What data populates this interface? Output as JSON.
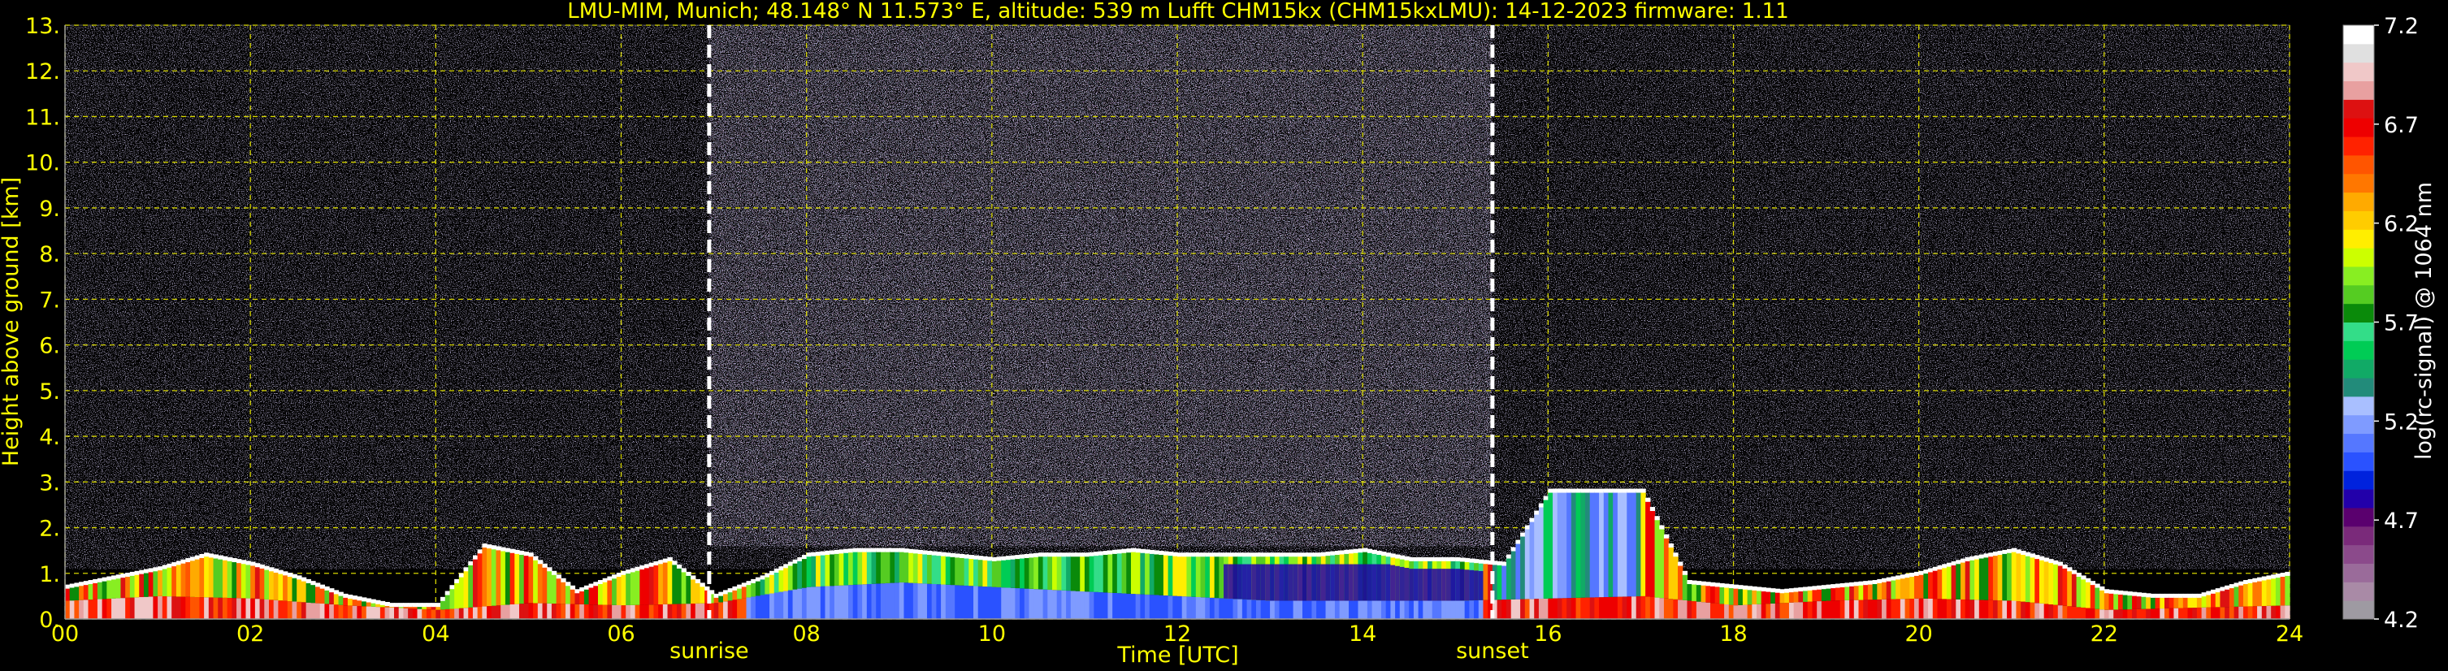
{
  "chart_data": {
    "type": "heatmap",
    "title": "LMU-MIM, Munich; 48.148° N 11.573° E, altitude: 539 m    Lufft CHM15kx (CHM15kxLMU): 14-12-2023    firmware: 1.11",
    "xlabel": "Time [UTC]",
    "ylabel": "Height above ground [km]",
    "xlim": [
      0,
      24
    ],
    "ylim": [
      0,
      13
    ],
    "x_ticks": [
      "00",
      "02",
      "04",
      "06",
      "08",
      "10",
      "12",
      "14",
      "16",
      "18",
      "20",
      "22",
      "24"
    ],
    "y_ticks": [
      "0.",
      "1.",
      "2.",
      "3.",
      "4.",
      "5.",
      "6.",
      "7.",
      "8.",
      "9.",
      "10.",
      "11.",
      "12.",
      "13."
    ],
    "grid": true,
    "markers": [
      {
        "label": "sunrise",
        "time": 6.95
      },
      {
        "label": "sunset",
        "time": 15.4
      }
    ],
    "colorbar": {
      "label": "log(rc-signal) @ 1064 nm",
      "range": [
        4.2,
        7.2
      ],
      "ticks": [
        "4.2",
        "4.7",
        "5.2",
        "5.7",
        "6.2",
        "6.7",
        "7.2"
      ],
      "colors": [
        "#9e9aa2",
        "#a98aa6",
        "#9a6b9a",
        "#8b4a8b",
        "#7a2a7a",
        "#5a006e",
        "#2200aa",
        "#0022dd",
        "#2a52ff",
        "#5577ff",
        "#7f9bff",
        "#a9bfff",
        "#228b7a",
        "#11aa66",
        "#00cc55",
        "#33dd88",
        "#0a8a0a",
        "#55cc22",
        "#88ee22",
        "#ccff00",
        "#ffee00",
        "#ffcc00",
        "#ffaa00",
        "#ff7700",
        "#ff5500",
        "#ff2200",
        "#ee0000",
        "#dd1111",
        "#e8a0a0",
        "#f0c8c8",
        "#e0e0e0",
        "#ffffff"
      ]
    },
    "series": [
      {
        "layer": "boundary_layer_top",
        "x": [
          0,
          0.5,
          1,
          1.5,
          2,
          2.5,
          3,
          3.5,
          4,
          4.5,
          5,
          5.5,
          6,
          6.5,
          7,
          7.5,
          8,
          8.5,
          9,
          9.5,
          10,
          10.5,
          11,
          11.5,
          12,
          12.5,
          13,
          13.5,
          14,
          14.5,
          15,
          15.5,
          16,
          16.5,
          17,
          17.5,
          18,
          18.5,
          19,
          19.5,
          20,
          20.5,
          21,
          21.5,
          22,
          22.5,
          23,
          23.5,
          24
        ],
        "y": [
          0.7,
          0.9,
          1.1,
          1.4,
          1.2,
          0.9,
          0.5,
          0.3,
          0.3,
          1.6,
          1.4,
          0.6,
          1.0,
          1.3,
          0.5,
          0.9,
          1.4,
          1.5,
          1.5,
          1.4,
          1.3,
          1.4,
          1.4,
          1.5,
          1.4,
          1.4,
          1.4,
          1.4,
          1.5,
          1.3,
          1.3,
          1.2,
          2.8,
          2.8,
          2.8,
          0.8,
          0.7,
          0.6,
          0.7,
          0.8,
          1.0,
          1.3,
          1.5,
          1.2,
          0.6,
          0.5,
          0.5,
          0.8,
          1.0
        ]
      },
      {
        "layer": "surface_layer_top",
        "x": [
          0,
          1,
          2,
          3,
          4,
          5,
          6,
          7,
          8,
          9,
          10,
          11,
          12,
          13,
          14,
          15,
          16,
          17,
          18,
          19,
          20,
          21,
          22,
          23,
          24
        ],
        "y": [
          0.4,
          0.5,
          0.45,
          0.3,
          0.2,
          0.35,
          0.3,
          0.35,
          0.7,
          0.8,
          0.7,
          0.6,
          0.5,
          0.4,
          0.4,
          0.4,
          0.45,
          0.5,
          0.3,
          0.4,
          0.45,
          0.4,
          0.2,
          0.25,
          0.3
        ]
      }
    ]
  }
}
